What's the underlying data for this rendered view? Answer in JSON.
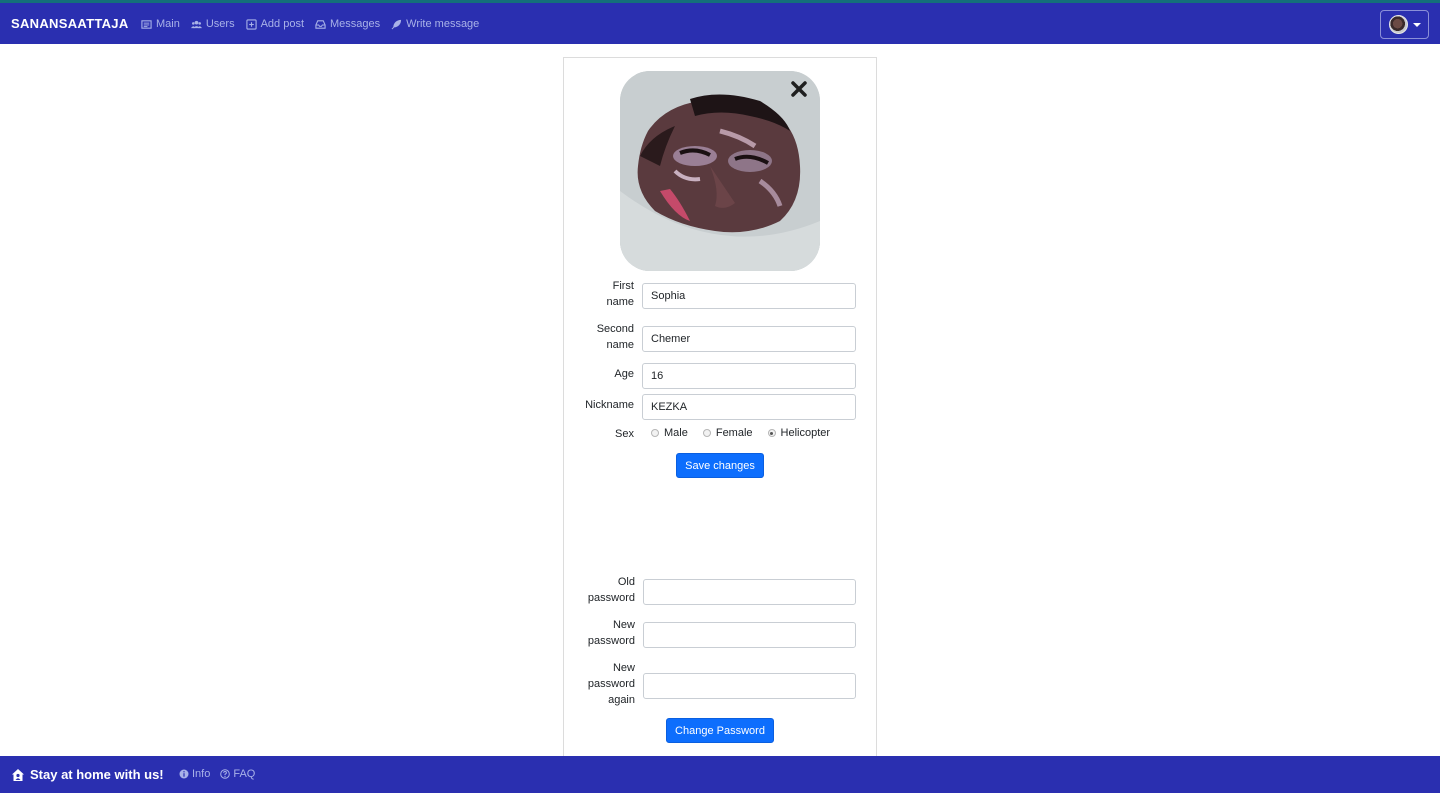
{
  "navbar": {
    "brand": "SANANSAATTAJA",
    "items": [
      {
        "label": "Main",
        "icon": "newspaper-icon"
      },
      {
        "label": "Users",
        "icon": "users-icon"
      },
      {
        "label": "Add post",
        "icon": "plus-square-icon"
      },
      {
        "label": "Messages",
        "icon": "inbox-icon"
      },
      {
        "label": "Write message",
        "icon": "feather-icon"
      }
    ],
    "account_icon": "user-avatar"
  },
  "profile": {
    "photo_icon": "profile-painting-image",
    "close_icon": "close-icon",
    "fields": {
      "first_name": {
        "label_1": "First",
        "label_2": "name",
        "value": "Sophia"
      },
      "second_name": {
        "label_1": "Second",
        "label_2": "name",
        "value": "Chemer"
      },
      "age": {
        "label": "Age",
        "value": "16"
      },
      "nickname": {
        "label": "Nickname",
        "value": "KEZKA"
      }
    },
    "sex": {
      "label": "Sex",
      "options": [
        "Male",
        "Female",
        "Helicopter"
      ],
      "selected": "Helicopter"
    },
    "save_label": "Save changes"
  },
  "password": {
    "old": {
      "label_1": "Old",
      "label_2": "password",
      "value": ""
    },
    "new": {
      "label_1": "New",
      "label_2": "password",
      "value": ""
    },
    "again": {
      "label_1": "New",
      "label_2": "password",
      "label_3": "again",
      "value": ""
    },
    "change_label": "Change Password"
  },
  "footer": {
    "brand": "Stay at home with us!",
    "brand_icon": "house-user-icon",
    "links": [
      {
        "label": "Info",
        "icon": "info-circle-icon"
      },
      {
        "label": "FAQ",
        "icon": "question-circle-icon"
      }
    ]
  },
  "colors": {
    "navbar_bg": "#2a2fb0",
    "accent_button": "#0d6efd",
    "nav_text": "#a9b2e8"
  }
}
